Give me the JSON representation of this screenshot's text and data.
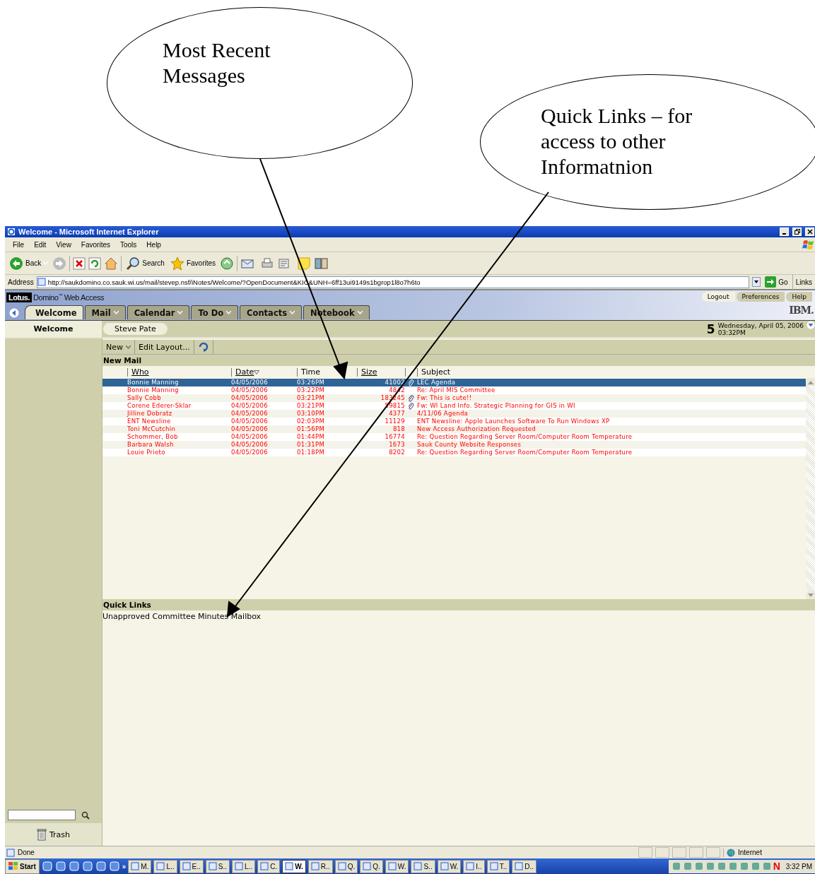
{
  "callouts": [
    {
      "text": "Most Recent Messages"
    },
    {
      "text": "Quick Links – for access to other Informatnion"
    }
  ],
  "window": {
    "title": "Welcome - Microsoft Internet Explorer"
  },
  "menu": [
    "File",
    "Edit",
    "View",
    "Favorites",
    "Tools",
    "Help"
  ],
  "ie_toolbar": {
    "back": "Back",
    "search": "Search",
    "favorites": "Favorites"
  },
  "address_bar": {
    "label": "Address",
    "url": "http://saukdomino.co.sauk.wi.us/mail/stevep.nsf/iNotes/Welcome/?OpenDocument&KIC&UNH=6ff13ui9149s1bgrop1l8o7h6to",
    "go": "Go",
    "links": "Links"
  },
  "app_header": {
    "logo": "Lotus.",
    "product": "Domino$^{™}$ Web Access",
    "links": [
      "Logout",
      "Preferences",
      "Help"
    ],
    "brand": "IBM."
  },
  "tabs": [
    {
      "label": "Welcome",
      "selected": true,
      "menu": false
    },
    {
      "label": "Mail",
      "selected": false,
      "menu": true
    },
    {
      "label": "Calendar",
      "selected": false,
      "menu": true
    },
    {
      "label": "To Do",
      "selected": false,
      "menu": true
    },
    {
      "label": "Contacts",
      "selected": false,
      "menu": true
    },
    {
      "label": "Notebook",
      "selected": false,
      "menu": true
    }
  ],
  "subheader": {
    "section": "Welcome",
    "user": "Steve Pate",
    "day": "5",
    "date": "Wednesday, April 05, 2006",
    "time": "03:32PM"
  },
  "content_toolbar": [
    {
      "label": "New",
      "menu": true
    },
    {
      "label": "Edit Layout...",
      "menu": false
    }
  ],
  "new_mail": {
    "title": "New Mail",
    "columns": [
      {
        "label": "Who",
        "link": true,
        "sorted": false
      },
      {
        "label": "Date",
        "link": true,
        "sorted": true
      },
      {
        "label": "Time",
        "link": false,
        "sorted": false
      },
      {
        "label": "Size",
        "link": true,
        "sorted": false
      },
      {
        "label": "Subject",
        "link": false,
        "sorted": false
      }
    ],
    "rows": [
      {
        "who": "Bonnie Manning",
        "date": "04/05/2006",
        "time": "03:26PM",
        "size": "41002",
        "attachment": true,
        "subject": "LEC Agenda",
        "selected": true
      },
      {
        "who": "Bonnie Manning",
        "date": "04/05/2006",
        "time": "03:22PM",
        "size": "4842",
        "attachment": false,
        "subject": "Re: April MIS Committee",
        "selected": false
      },
      {
        "who": "Sally Cobb",
        "date": "04/05/2006",
        "time": "03:21PM",
        "size": "183245",
        "attachment": true,
        "subject": "Fw: This is cute!!",
        "selected": false
      },
      {
        "who": "Corene Ederer-Sklar",
        "date": "04/05/2006",
        "time": "03:21PM",
        "size": "59815",
        "attachment": true,
        "subject": "Fw: WI Land Info. Strategic Planning for GIS in WI",
        "selected": false
      },
      {
        "who": "Jilline Dobratz",
        "date": "04/05/2006",
        "time": "03:10PM",
        "size": "4377",
        "attachment": false,
        "subject": "4/11/06 Agenda",
        "selected": false
      },
      {
        "who": "ENT Newsline",
        "date": "04/05/2006",
        "time": "02:03PM",
        "size": "11129",
        "attachment": false,
        "subject": "ENT Newsline: Apple Launches Software To Run Windows XP",
        "selected": false
      },
      {
        "who": "Toni McCutchin",
        "date": "04/05/2006",
        "time": "01:56PM",
        "size": "818",
        "attachment": false,
        "subject": "New Access Authorization Requested",
        "selected": false
      },
      {
        "who": "Schommer, Bob",
        "date": "04/05/2006",
        "time": "01:44PM",
        "size": "16774",
        "attachment": false,
        "subject": "Re: Question Regarding Server Room/Computer Room Temperature",
        "selected": false
      },
      {
        "who": "Barbara Walsh",
        "date": "04/05/2006",
        "time": "01:31PM",
        "size": "1673",
        "attachment": false,
        "subject": "Sauk County Website Responses",
        "selected": false
      },
      {
        "who": "Louie Prieto",
        "date": "04/05/2006",
        "time": "01:18PM",
        "size": "8202",
        "attachment": false,
        "subject": "Re: Question Regarding Server Room/Computer Room Temperature",
        "selected": false
      }
    ]
  },
  "quick_links": {
    "title": "Quick Links",
    "items": [
      "Unapproved Committee Minutes Mailbox"
    ]
  },
  "sidebar": {
    "trash": "Trash"
  },
  "status_bar": {
    "text": "Done",
    "zone": "Internet"
  },
  "taskbar": {
    "start": "Start",
    "more": "»",
    "tasks": [
      {
        "label": "M.",
        "selected": false
      },
      {
        "label": "L..",
        "selected": false
      },
      {
        "label": "E..",
        "selected": false
      },
      {
        "label": "S..",
        "selected": false
      },
      {
        "label": "L..",
        "selected": false
      },
      {
        "label": "C.",
        "selected": false
      },
      {
        "label": "W.",
        "selected": true
      },
      {
        "label": "R..",
        "selected": false
      },
      {
        "label": "Q.",
        "selected": false
      },
      {
        "label": "Q.",
        "selected": false
      },
      {
        "label": "W.",
        "selected": false
      },
      {
        "label": "S..",
        "selected": false
      },
      {
        "label": "W.",
        "selected": false
      },
      {
        "label": "I..",
        "selected": false
      },
      {
        "label": "T..",
        "selected": false
      },
      {
        "label": "D..",
        "selected": false
      }
    ],
    "tray_letter": "N",
    "clock": "3:32 PM"
  }
}
